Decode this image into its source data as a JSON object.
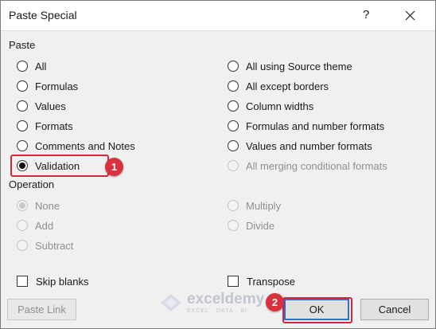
{
  "dialog": {
    "title": "Paste Special",
    "help": "?"
  },
  "paste": {
    "label": "Paste",
    "left": [
      "All",
      "Formulas",
      "Values",
      "Formats",
      "Comments and Notes",
      "Validation"
    ],
    "right": [
      "All using Source theme",
      "All except borders",
      "Column widths",
      "Formulas and number formats",
      "Values and number formats",
      "All merging conditional formats"
    ],
    "selected": "Validation"
  },
  "operation": {
    "label": "Operation",
    "left": [
      "None",
      "Add",
      "Subtract"
    ],
    "right": [
      "Multiply",
      "Divide"
    ],
    "selected": "None",
    "enabled": false
  },
  "checkboxes": {
    "skip_blanks": "Skip blanks",
    "transpose": "Transpose"
  },
  "buttons": {
    "paste_link": "Paste Link",
    "ok": "OK",
    "cancel": "Cancel"
  },
  "annotations": {
    "step1": "1",
    "step2": "2"
  },
  "watermark": {
    "name": "exceldemy",
    "tagline": "EXCEL · DATA · BI"
  },
  "colors": {
    "annotation_red": "#d8323f",
    "default_button_border": "#2f6fc9"
  }
}
